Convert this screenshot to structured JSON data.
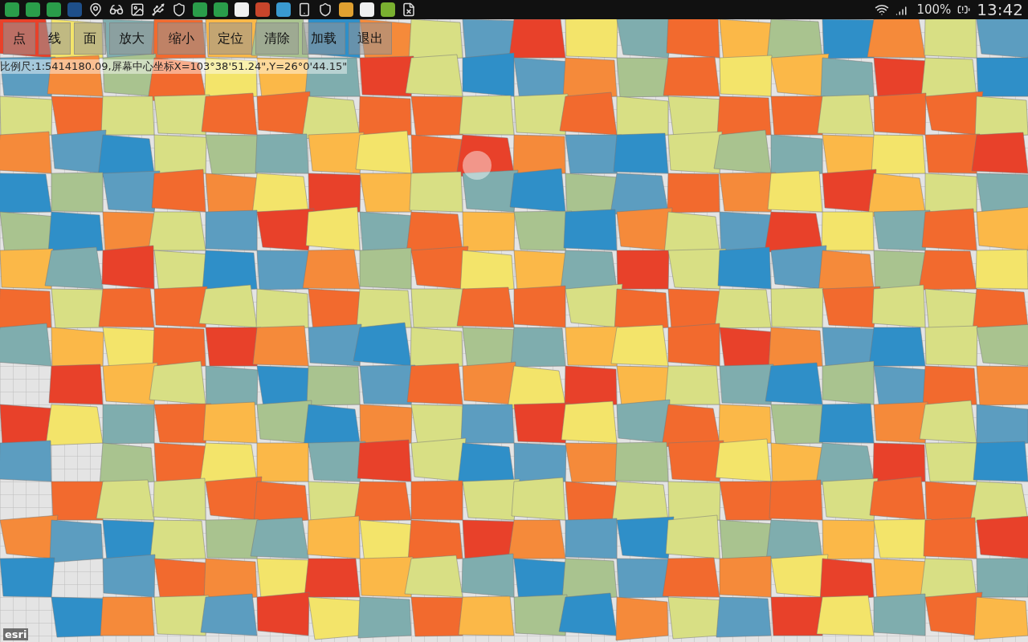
{
  "status_bar": {
    "battery": "100%",
    "time": "13:42"
  },
  "toolbar": {
    "buttons": [
      "点",
      "线",
      "面",
      "放大",
      "缩小",
      "定位",
      "清除",
      "加载",
      "退出"
    ]
  },
  "scale_info": "比例尺:1:5414180.09,屏幕中心坐标X=103°38'51.24\",Y=26°0'44.15\"",
  "map": {
    "attribution": "esri"
  }
}
